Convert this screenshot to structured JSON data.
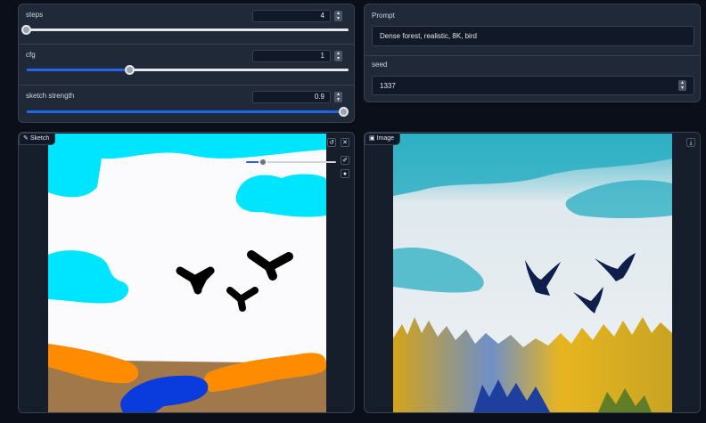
{
  "controls": {
    "steps": {
      "label": "steps",
      "value": "4",
      "level": 0.0
    },
    "cfg": {
      "label": "cfg",
      "value": "1",
      "level": 0.32
    },
    "sketch_strength": {
      "label": "sketch strength",
      "value": "0.9",
      "level": 1.0
    }
  },
  "prompt": {
    "label": "Prompt",
    "value": "Dense forest, realistic, 8K, bird"
  },
  "seed": {
    "label": "seed",
    "value": "1337"
  },
  "sketch": {
    "tab_label": "Sketch",
    "brush_size_level": 0.2
  },
  "image": {
    "tab_label": "Image"
  },
  "colors": {
    "accent": "#2563eb",
    "panel": "#1f2937",
    "background": "#0b0f19",
    "sketch_cyan": "#00e5ff",
    "sketch_orange": "#ff8c00",
    "sketch_brown": "#a0784a",
    "sketch_blue": "#0a3bdc"
  },
  "icons": {
    "sketch_tab": "pencil-icon",
    "image_tab": "image-icon",
    "undo": "undo-icon",
    "clear": "close-icon",
    "brush": "brush-icon",
    "color": "palette-icon",
    "download": "download-icon",
    "spin_up": "chevron-up-icon",
    "spin_down": "chevron-down-icon"
  }
}
